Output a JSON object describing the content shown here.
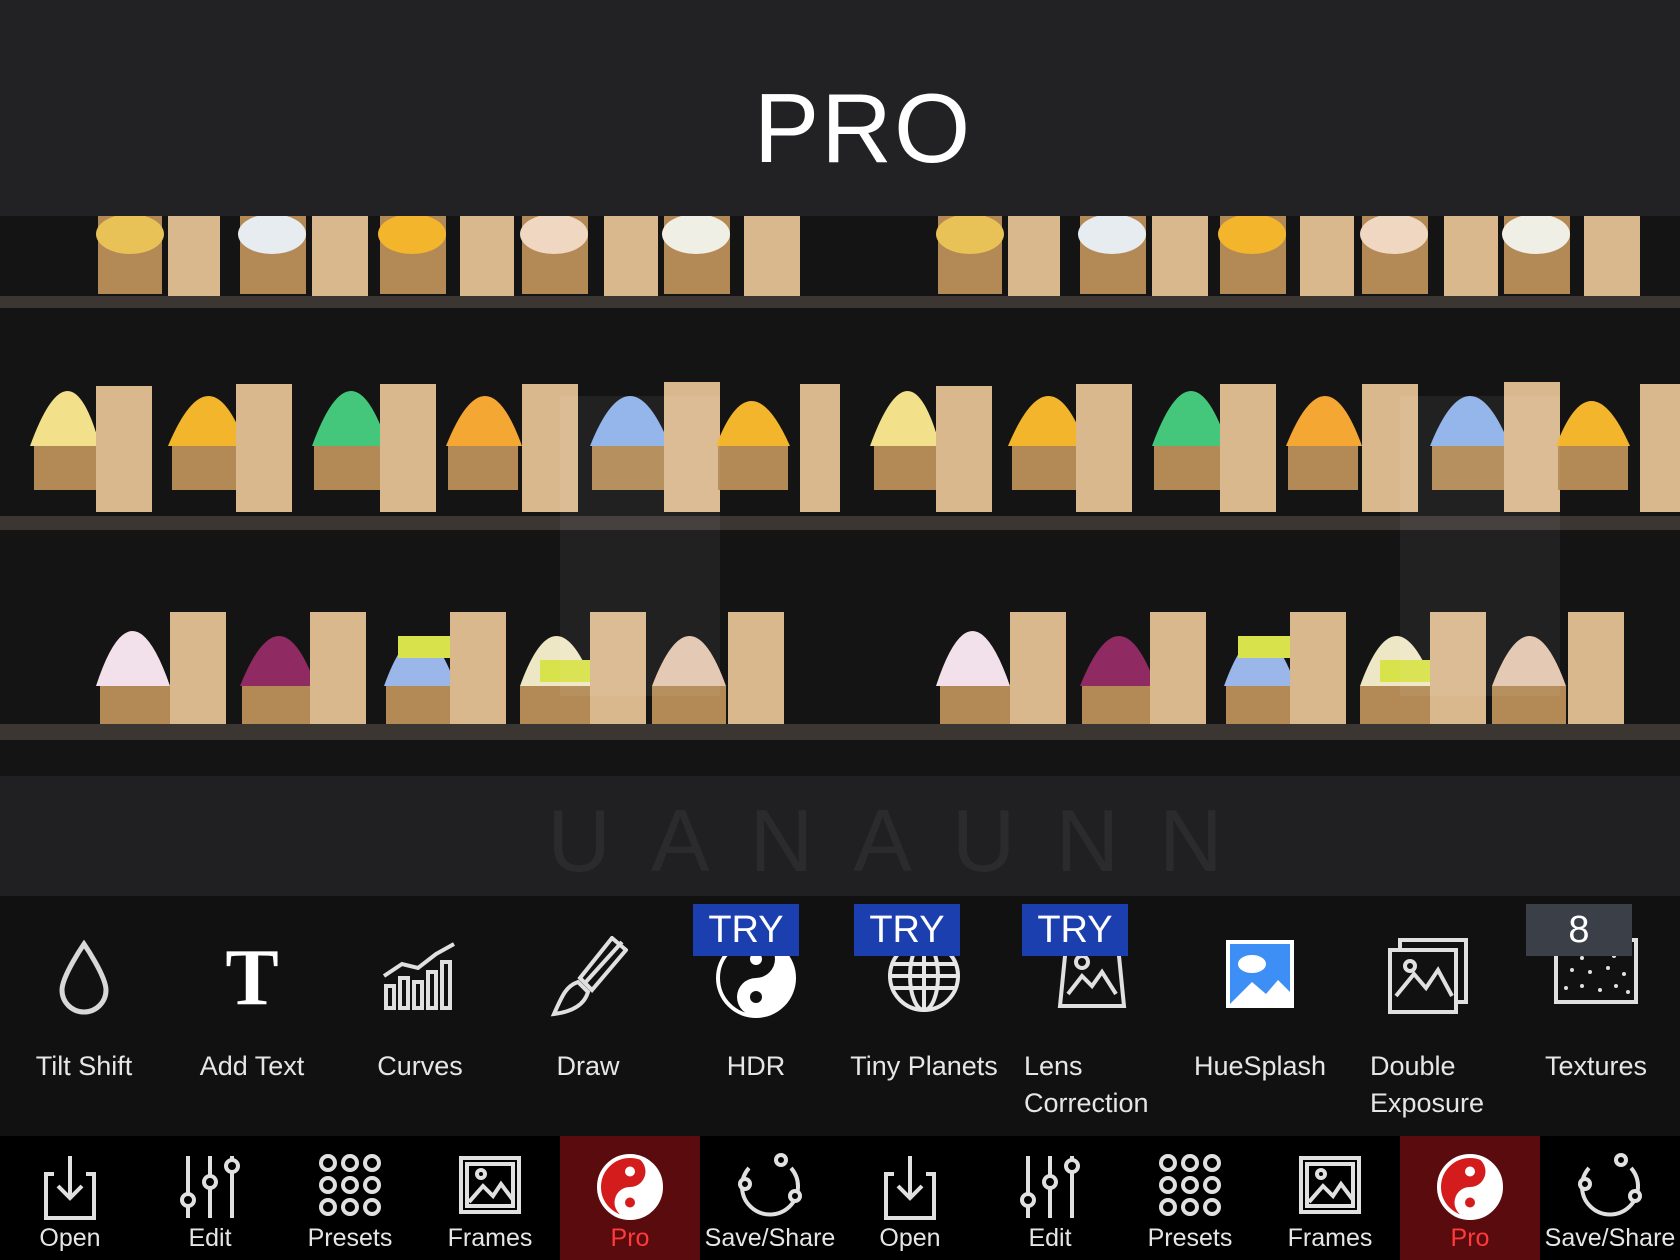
{
  "header": {
    "title": "PRO"
  },
  "watermark": "UANAUNN",
  "tools": [
    {
      "id": "tilt-shift",
      "label": "Tilt Shift",
      "icon": "droplet-icon",
      "badge": ""
    },
    {
      "id": "add-text",
      "label": "Add Text",
      "icon": "text-icon",
      "badge": ""
    },
    {
      "id": "curves",
      "label": "Curves",
      "icon": "curves-icon",
      "badge": ""
    },
    {
      "id": "draw",
      "label": "Draw",
      "icon": "brush-icon",
      "badge": ""
    },
    {
      "id": "hdr",
      "label": "HDR",
      "icon": "yin-yang-icon",
      "badge": "TRY"
    },
    {
      "id": "tiny-planets",
      "label": "Tiny Planets",
      "icon": "globe-icon",
      "badge": "TRY"
    },
    {
      "id": "lens-correction",
      "label": "Lens Correction",
      "label_line1": "Lens",
      "label_line2": "Correction",
      "icon": "lens-frame-icon",
      "badge": "TRY"
    },
    {
      "id": "huesplash",
      "label": "HueSplash",
      "icon": "picture-icon",
      "badge": ""
    },
    {
      "id": "double-exposure",
      "label": "Double Exposure",
      "label_line1": "Double",
      "label_line2": "Exposure",
      "icon": "double-photo-icon",
      "badge": ""
    },
    {
      "id": "textures",
      "label": "Textures",
      "icon": "texture-icon",
      "badge": "8"
    }
  ],
  "nav": [
    {
      "label": "Open",
      "icon": "download-tray-icon"
    },
    {
      "label": "Edit",
      "icon": "sliders-icon"
    },
    {
      "label": "Presets",
      "icon": "dots-grid-icon"
    },
    {
      "label": "Frames",
      "icon": "frame-icon"
    },
    {
      "label": "Pro",
      "icon": "yin-yang-icon",
      "active": true
    },
    {
      "label": "Save/Share",
      "icon": "share-circle-icon"
    },
    {
      "label": "Open",
      "icon": "download-tray-icon"
    },
    {
      "label": "Edit",
      "icon": "sliders-icon"
    },
    {
      "label": "Presets",
      "icon": "dots-grid-icon"
    },
    {
      "label": "Frames",
      "icon": "frame-icon"
    },
    {
      "label": "Pro",
      "icon": "yin-yang-icon",
      "active": true
    },
    {
      "label": "Save/Share",
      "icon": "share-circle-icon"
    }
  ],
  "colors": {
    "badge_try": "#1c3fb0",
    "badge_count": "#3a3f48",
    "nav_active_bg": "#5a0b0e",
    "nav_active_text": "#ff3a3a"
  }
}
